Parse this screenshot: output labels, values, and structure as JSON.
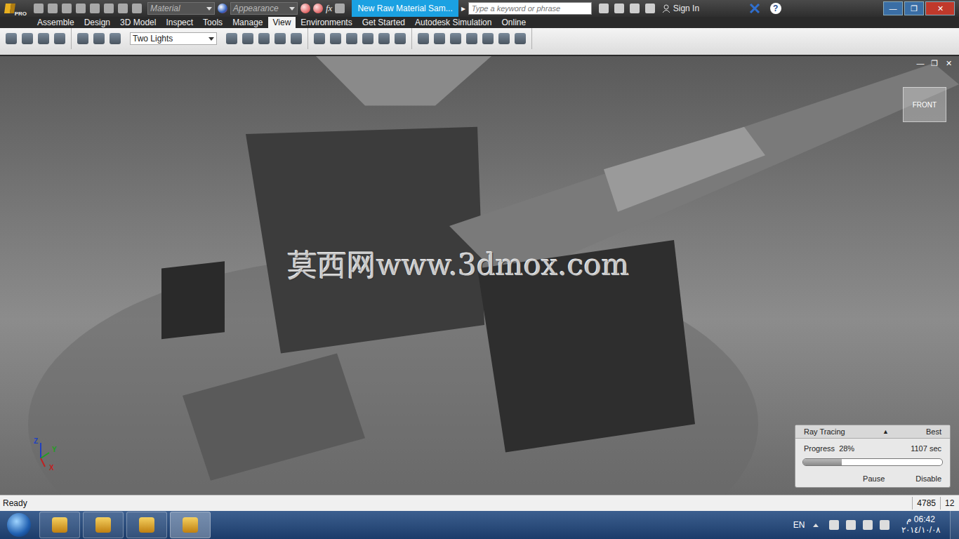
{
  "app": {
    "badge": "PRO"
  },
  "quick_access": {
    "material": "Material",
    "appearance": "Appearance",
    "formula": "fx"
  },
  "window": {
    "title": "New Raw Material Sam...",
    "arrow": "▸"
  },
  "search": {
    "placeholder": "Type a keyword or phrase"
  },
  "account": {
    "label": "Sign In"
  },
  "help": "?",
  "window_controls": [
    "—",
    "❐",
    "✕"
  ],
  "tabs": [
    {
      "label": "Assemble",
      "selected": false
    },
    {
      "label": "Design",
      "selected": false
    },
    {
      "label": "3D Model",
      "selected": false
    },
    {
      "label": "Inspect",
      "selected": false
    },
    {
      "label": "Tools",
      "selected": false
    },
    {
      "label": "Manage",
      "selected": false
    },
    {
      "label": "View",
      "selected": true
    },
    {
      "label": "Environments",
      "selected": false
    },
    {
      "label": "Get Started",
      "selected": false
    },
    {
      "label": "Autodesk Simulation",
      "selected": false
    },
    {
      "label": "Online",
      "selected": false
    }
  ],
  "ribbon": {
    "lighting": "Two Lights"
  },
  "viewport": {
    "watermark": "莫西网www.3dmox.com",
    "viewcube": "FRONT",
    "axes": [
      "Z",
      "Y",
      "X"
    ],
    "controls": [
      "—",
      "❐",
      "✕"
    ]
  },
  "ray_tracing": {
    "title": "Ray Tracing",
    "toggle": "▲",
    "quality": "Best",
    "progress_label": "Progress",
    "progress": "28%",
    "time": "1107 sec",
    "level": 0.28,
    "buttons": [
      "Pause",
      "Disable"
    ]
  },
  "status_bar": {
    "message": "Ready",
    "count": "4785",
    "extra": "12"
  },
  "taskbar": {
    "language": "EN",
    "time": "06:42 م",
    "date": "٢٠١٤/١٠/٠٨"
  }
}
